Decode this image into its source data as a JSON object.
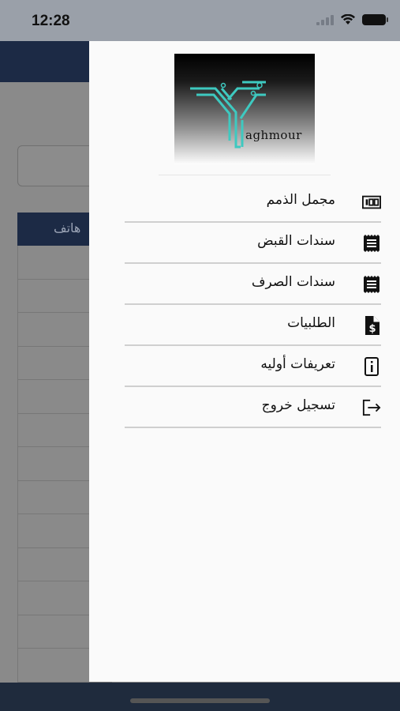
{
  "status_bar": {
    "time": "12:28"
  },
  "background_page": {
    "table_header_label": "هاتف"
  },
  "drawer": {
    "logo_text": "aghmour",
    "items": [
      {
        "label": "مجمل الذمم",
        "icon": "counter-icon"
      },
      {
        "label": "سندات القبض",
        "icon": "receipt-icon"
      },
      {
        "label": "سندات الصرف",
        "icon": "receipt-icon"
      },
      {
        "label": "الطلبيات",
        "icon": "invoice-dollar-icon"
      },
      {
        "label": "تعريفات أوليه",
        "icon": "info-icon"
      },
      {
        "label": "تسجيل خروج",
        "icon": "logout-icon"
      }
    ]
  },
  "colors": {
    "header_navy": "#1c2a45",
    "drawer_bg": "#fafafa",
    "logo_teal": "#3ec9c0",
    "divider": "#cfcfcf"
  }
}
